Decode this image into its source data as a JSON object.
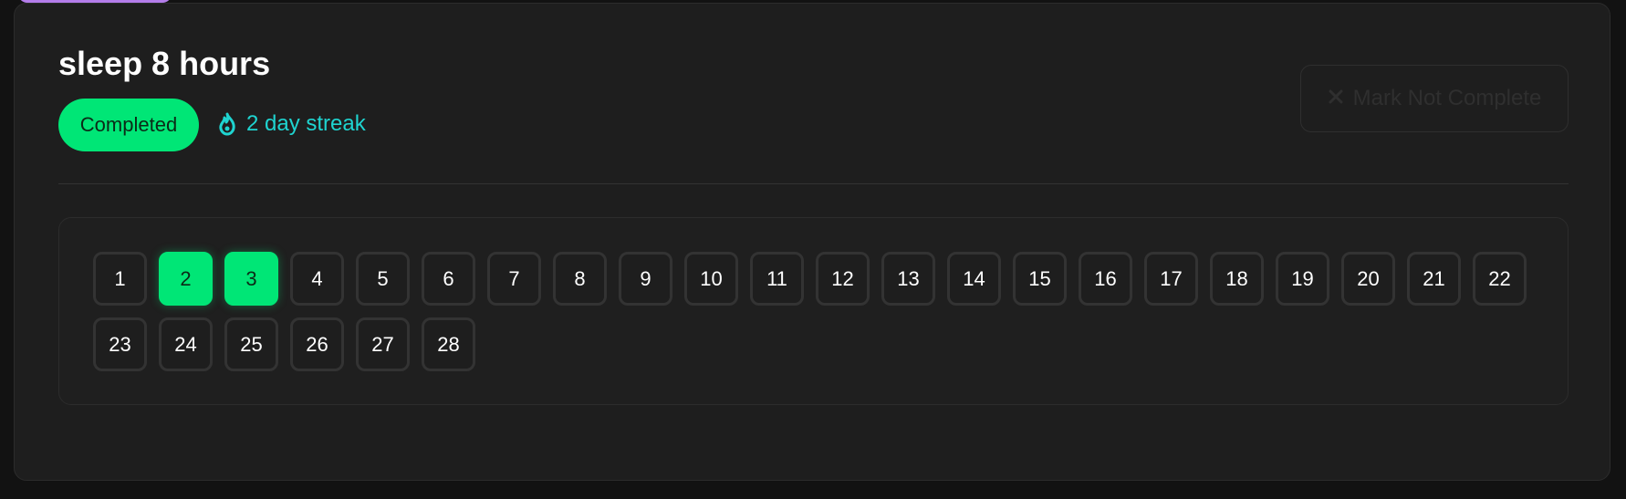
{
  "habit": {
    "title": "sleep 8 hours",
    "status": "Completed",
    "streak_label": "2 day streak"
  },
  "actions": {
    "mark_not_complete": "Mark Not Complete"
  },
  "icons": {
    "streak": "flame-icon",
    "mark_not_complete": "close-icon"
  },
  "colors": {
    "completed": "#00e676",
    "streak": "#1fd4d0",
    "accent": "#b47dea"
  },
  "calendar": {
    "days": [
      {
        "label": "1",
        "completed": false
      },
      {
        "label": "2",
        "completed": true
      },
      {
        "label": "3",
        "completed": true
      },
      {
        "label": "4",
        "completed": false
      },
      {
        "label": "5",
        "completed": false
      },
      {
        "label": "6",
        "completed": false
      },
      {
        "label": "7",
        "completed": false
      },
      {
        "label": "8",
        "completed": false
      },
      {
        "label": "9",
        "completed": false
      },
      {
        "label": "10",
        "completed": false
      },
      {
        "label": "11",
        "completed": false
      },
      {
        "label": "12",
        "completed": false
      },
      {
        "label": "13",
        "completed": false
      },
      {
        "label": "14",
        "completed": false
      },
      {
        "label": "15",
        "completed": false
      },
      {
        "label": "16",
        "completed": false
      },
      {
        "label": "17",
        "completed": false
      },
      {
        "label": "18",
        "completed": false
      },
      {
        "label": "19",
        "completed": false
      },
      {
        "label": "20",
        "completed": false
      },
      {
        "label": "21",
        "completed": false
      },
      {
        "label": "22",
        "completed": false
      },
      {
        "label": "23",
        "completed": false
      },
      {
        "label": "24",
        "completed": false
      },
      {
        "label": "25",
        "completed": false
      },
      {
        "label": "26",
        "completed": false
      },
      {
        "label": "27",
        "completed": false
      },
      {
        "label": "28",
        "completed": false
      }
    ]
  }
}
